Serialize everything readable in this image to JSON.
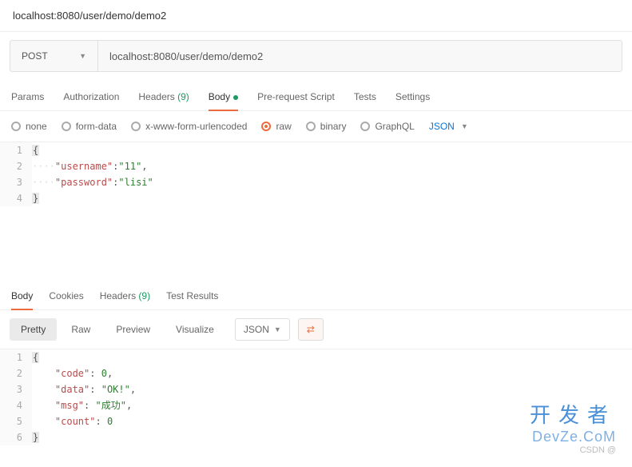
{
  "header": {
    "url": "localhost:8080/user/demo/demo2"
  },
  "request": {
    "method": "POST",
    "url": "localhost:8080/user/demo/demo2"
  },
  "reqTabs": [
    {
      "label": "Params",
      "active": false
    },
    {
      "label": "Authorization",
      "active": false
    },
    {
      "label": "Headers",
      "count": "(9)",
      "active": false
    },
    {
      "label": "Body",
      "active": true,
      "dot": true
    },
    {
      "label": "Pre-request Script",
      "active": false
    },
    {
      "label": "Tests",
      "active": false
    },
    {
      "label": "Settings",
      "active": false
    }
  ],
  "bodyTypes": {
    "options": [
      "none",
      "form-data",
      "x-www-form-urlencoded",
      "raw",
      "binary",
      "GraphQL"
    ],
    "selected": "raw",
    "format": "JSON"
  },
  "requestBody": {
    "lines": [
      {
        "n": "1",
        "tokens": [
          {
            "t": "brace",
            "v": "{"
          }
        ]
      },
      {
        "n": "2",
        "tokens": [
          {
            "t": "ws",
            "v": "····"
          },
          {
            "t": "key",
            "v": "\"username\""
          },
          {
            "t": "colon",
            "v": ":"
          },
          {
            "t": "str",
            "v": "\"11\""
          },
          {
            "t": "colon",
            "v": ","
          }
        ]
      },
      {
        "n": "3",
        "tokens": [
          {
            "t": "ws",
            "v": "····"
          },
          {
            "t": "key",
            "v": "\"password\""
          },
          {
            "t": "colon",
            "v": ":"
          },
          {
            "t": "str",
            "v": "\"lisi\""
          }
        ]
      },
      {
        "n": "4",
        "tokens": [
          {
            "t": "brace",
            "v": "}"
          }
        ]
      }
    ]
  },
  "respTabs": [
    {
      "label": "Body",
      "active": true
    },
    {
      "label": "Cookies",
      "active": false
    },
    {
      "label": "Headers",
      "count": "(9)",
      "active": false
    },
    {
      "label": "Test Results",
      "active": false
    }
  ],
  "viewModes": {
    "options": [
      "Pretty",
      "Raw",
      "Preview",
      "Visualize"
    ],
    "selected": "Pretty",
    "format": "JSON"
  },
  "responseBody": {
    "lines": [
      {
        "n": "1",
        "tokens": [
          {
            "t": "brace",
            "v": "{"
          }
        ]
      },
      {
        "n": "2",
        "tokens": [
          {
            "t": "ws",
            "v": "    "
          },
          {
            "t": "key",
            "v": "\"code\""
          },
          {
            "t": "colon",
            "v": ": "
          },
          {
            "t": "num",
            "v": "0"
          },
          {
            "t": "colon",
            "v": ","
          }
        ]
      },
      {
        "n": "3",
        "tokens": [
          {
            "t": "ws",
            "v": "    "
          },
          {
            "t": "key",
            "v": "\"data\""
          },
          {
            "t": "colon",
            "v": ": "
          },
          {
            "t": "str",
            "v": "\"OK!\""
          },
          {
            "t": "colon",
            "v": ","
          }
        ]
      },
      {
        "n": "4",
        "tokens": [
          {
            "t": "ws",
            "v": "    "
          },
          {
            "t": "key",
            "v": "\"msg\""
          },
          {
            "t": "colon",
            "v": ": "
          },
          {
            "t": "str",
            "v": "\"成功\""
          },
          {
            "t": "colon",
            "v": ","
          }
        ]
      },
      {
        "n": "5",
        "tokens": [
          {
            "t": "ws",
            "v": "    "
          },
          {
            "t": "key",
            "v": "\"count\""
          },
          {
            "t": "colon",
            "v": ": "
          },
          {
            "t": "num",
            "v": "0"
          }
        ]
      },
      {
        "n": "6",
        "tokens": [
          {
            "t": "brace",
            "v": "}"
          }
        ]
      }
    ]
  },
  "watermark": {
    "big": "开发者",
    "sm": "DevZe.CoM",
    "csdn": "CSDN @"
  }
}
